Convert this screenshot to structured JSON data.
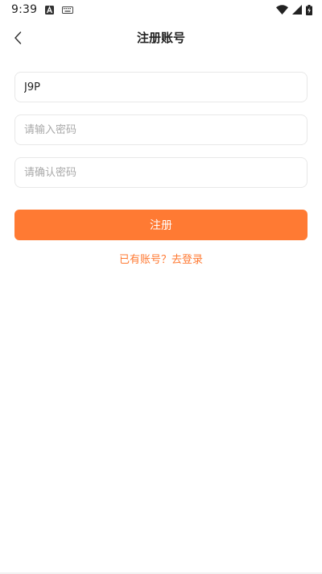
{
  "status_bar": {
    "time": "9:39",
    "icons": [
      "a-letter-icon",
      "keyboard-icon",
      "wifi-icon",
      "signal-icon",
      "battery-charging-icon"
    ]
  },
  "header": {
    "title": "注册账号",
    "back_icon": "chevron-left-icon"
  },
  "form": {
    "username": {
      "value": "J9P",
      "placeholder": ""
    },
    "password": {
      "value": "",
      "placeholder": "请输入密码"
    },
    "confirm_password": {
      "value": "",
      "placeholder": "请确认密码"
    },
    "submit_label": "注册"
  },
  "login_prompt": {
    "text": "已有账号？去登录"
  },
  "colors": {
    "accent": "#ff7a33",
    "border": "#e8e8e8",
    "placeholder": "#a9a9a9",
    "text": "#222222"
  }
}
